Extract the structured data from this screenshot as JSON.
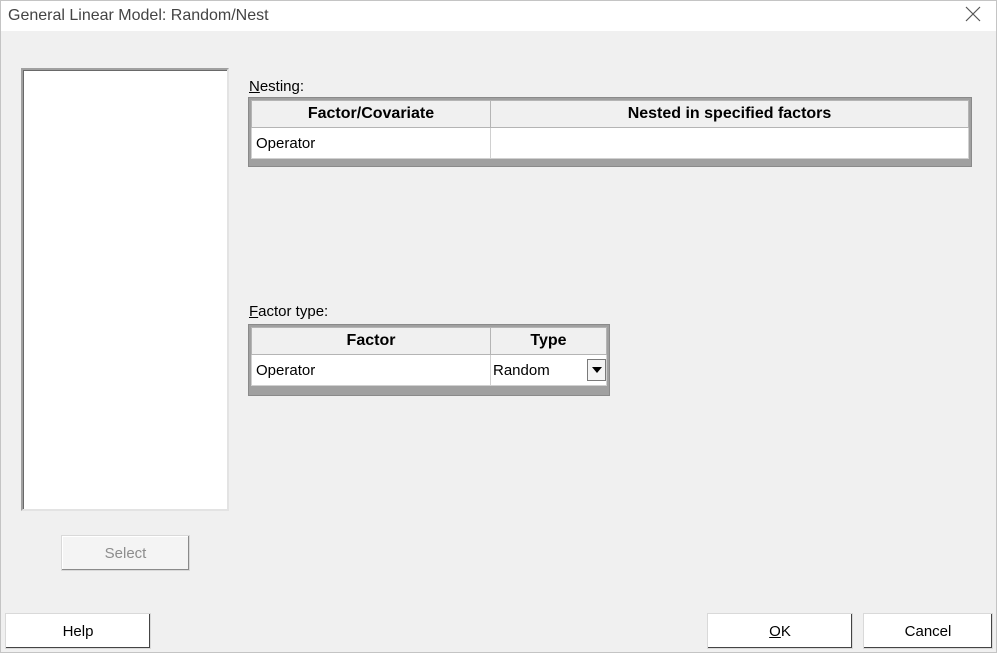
{
  "window": {
    "title": "General Linear Model: Random/Nest"
  },
  "nesting": {
    "label": "Nesting:",
    "columns": [
      "Factor/Covariate",
      "Nested in specified factors"
    ],
    "rows": [
      {
        "factor": "Operator",
        "nested_in": ""
      }
    ]
  },
  "factor_type": {
    "label": "Factor type:",
    "columns": [
      "Factor",
      "Type"
    ],
    "rows": [
      {
        "factor": "Operator",
        "type": "Random"
      }
    ]
  },
  "buttons": {
    "select": "Select",
    "help": "Help",
    "ok": "OK",
    "cancel": "Cancel"
  },
  "icons": {
    "close": "close-icon",
    "dropdown": "dropdown-arrow-icon"
  },
  "colors": {
    "dialog_bg": "#f0f0f0",
    "titlebar_bg": "#ffffff",
    "disabled_text": "#8d8d8d"
  }
}
